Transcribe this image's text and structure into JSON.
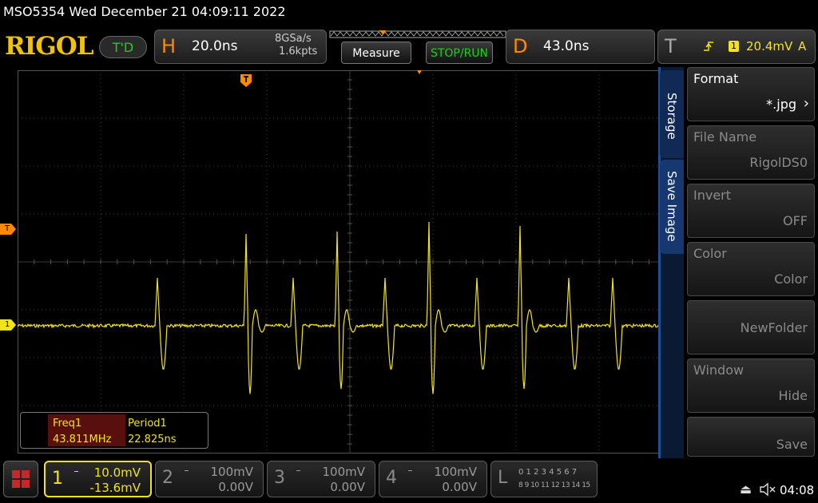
{
  "title_bar": {
    "text": "MSO5354  Wed December 21 04:09:11 2022"
  },
  "header": {
    "logo": "RIGOL",
    "mode": "T'D",
    "horizontal": {
      "letter": "H",
      "timebase": "20.0ns",
      "sample_rate": "8GSa/s",
      "memory_depth": "1.6kpts"
    },
    "measure_button": "Measure",
    "stop_run_button": "STOP/RUN",
    "delay": {
      "letter": "D",
      "value": "43.0ns"
    },
    "trigger": {
      "letter": "T",
      "channel": "1",
      "level": "20.4mV",
      "mode": "A"
    }
  },
  "colors": {
    "channel1": "#f2e31a",
    "accent_orange": "#ff8a00",
    "green": "#1bd11b",
    "menu_blue": "#1f4f9a"
  },
  "markers": {
    "trigger_level_label": "T",
    "channel1_label": "1"
  },
  "measurements": {
    "labels": [
      "Freq1",
      "Period1"
    ],
    "values": [
      "43.811MHz",
      "22.825ns"
    ]
  },
  "side_tabs": [
    "Storage",
    "Save Image"
  ],
  "side_menu": [
    {
      "label": "Format",
      "value": "*.jpg",
      "enabled": true
    },
    {
      "label": "File Name",
      "value": "RigolDS0",
      "enabled": false
    },
    {
      "label": "Invert",
      "value": "OFF",
      "enabled": false
    },
    {
      "label": "Color",
      "value": "Color",
      "enabled": false
    },
    {
      "label": "",
      "value": "NewFolder",
      "enabled": false
    },
    {
      "label": "Window",
      "value": "Hide",
      "enabled": false
    },
    {
      "label": "",
      "value": "Save",
      "enabled": false
    }
  ],
  "channels": [
    {
      "num": "1",
      "scale": "10.0mV",
      "offset": "-13.6mV",
      "active": true
    },
    {
      "num": "2",
      "scale": "100mV",
      "offset": "0.00V",
      "active": false
    },
    {
      "num": "3",
      "scale": "100mV",
      "offset": "0.00V",
      "active": false
    },
    {
      "num": "4",
      "scale": "100mV",
      "offset": "0.00V",
      "active": false
    }
  ],
  "logic": {
    "letter": "L",
    "row1": "0 1 2 3  4 5 6 7",
    "row2": "8 9 10 11 12 13 14 15"
  },
  "status": {
    "time": "04:08"
  }
}
